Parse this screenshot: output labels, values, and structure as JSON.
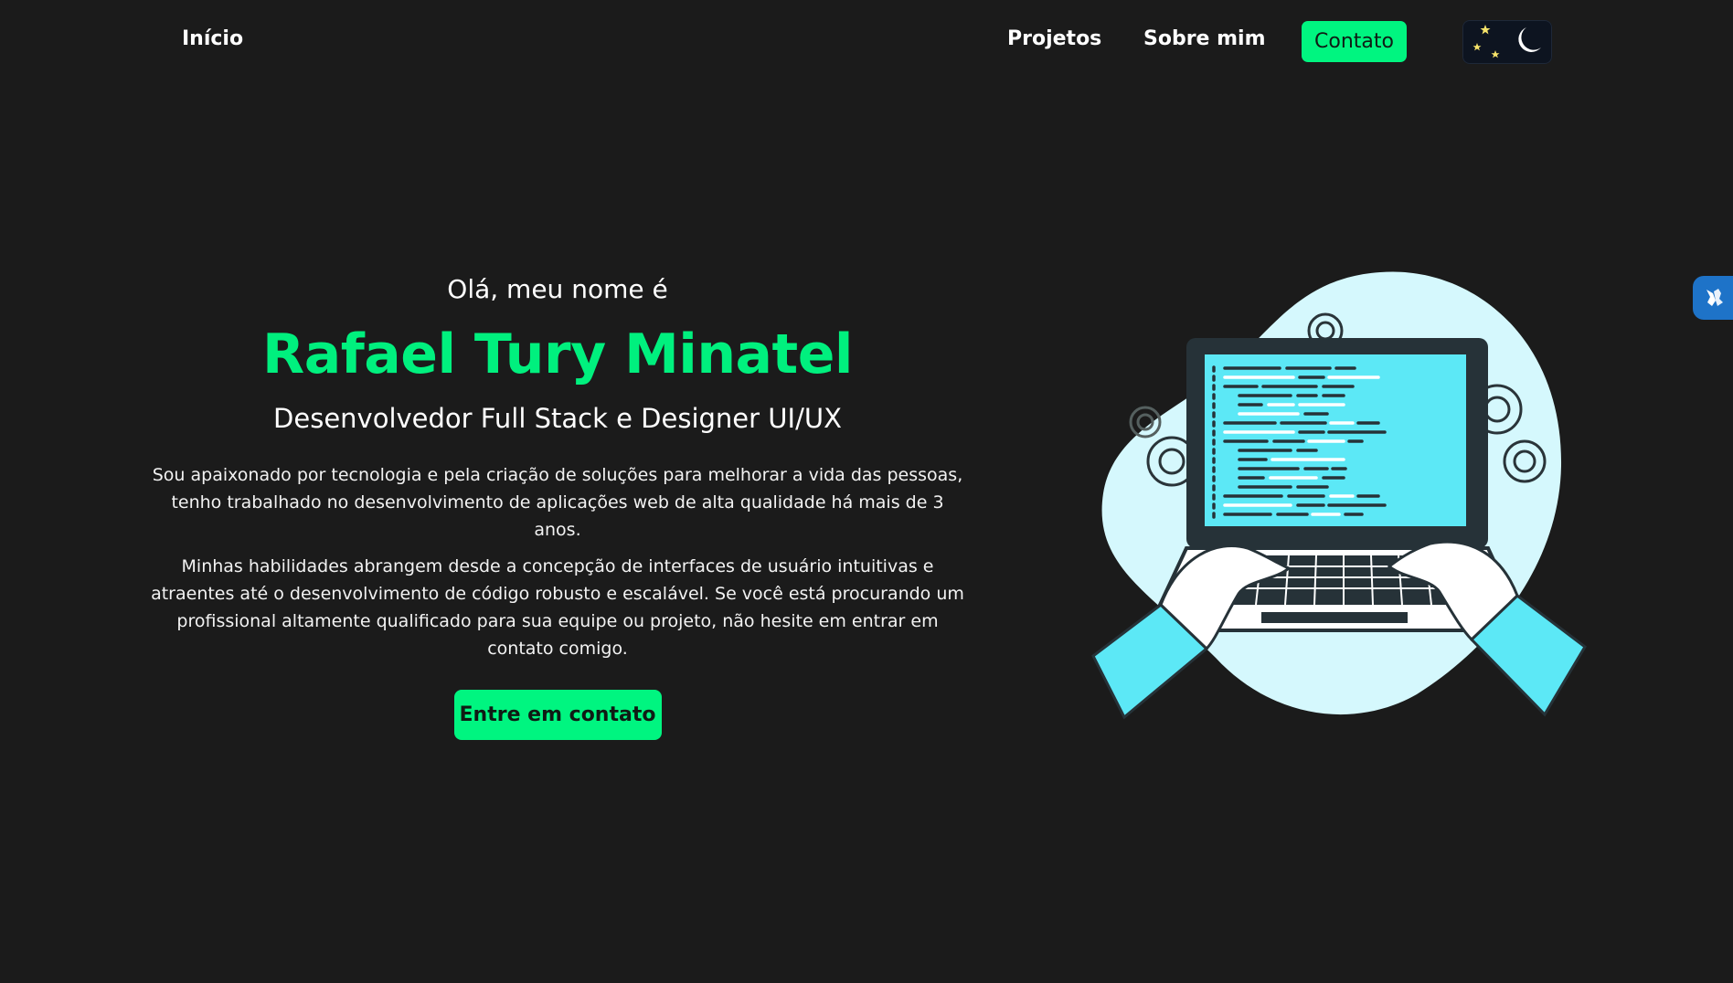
{
  "nav": {
    "home": "Início",
    "projects": "Projetos",
    "about": "Sobre mim",
    "contact": "Contato"
  },
  "theme_toggle": {
    "icon": "moon-stars-icon",
    "mode": "dark"
  },
  "hero": {
    "greeting": "Olá, meu nome é",
    "name": "Rafael Tury Minatel",
    "role": "Desenvolvedor Full Stack e Designer UI/UX",
    "paragraph1": "Sou apaixonado por tecnologia e pela criação de soluções para melhorar a vida das pessoas, tenho trabalhado no desenvolvimento de aplicações web de alta qualidade há mais de 3 anos.",
    "paragraph2": "Minhas habilidades abrangem desde a concepção de interfaces de usuário intuitivas e atraentes até o desenvolvimento de código robusto e escalável. Se você está procurando um profissional altamente qualificado para sua equipe ou projeto, não hesite em entrar em contato comigo.",
    "cta": "Entre em contato"
  },
  "illustration": {
    "icon": "developer-laptop-illustration"
  },
  "accessibility": {
    "icon": "sign-language-hands-icon"
  },
  "colors": {
    "background": "#1b1b1b",
    "accent": "#00f580",
    "name": "#00f07e",
    "illustration_blob": "#d5f8fd",
    "illustration_cyan": "#5ce8f6"
  }
}
